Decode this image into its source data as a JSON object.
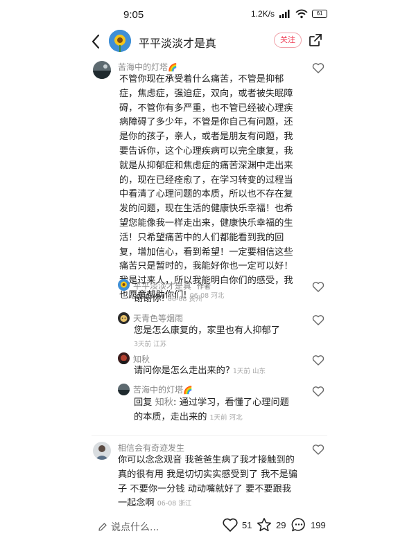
{
  "status_bar": {
    "time": "9:05",
    "network_speed": "1.2K/s",
    "battery": "61"
  },
  "header": {
    "author_name": "平平淡淡才是真",
    "follow_label": "关注"
  },
  "comments": [
    {
      "username": "苦海中的灯塔",
      "emoji": "🌈",
      "text_lines": [
        "不管你现在承受着什么痛苦，不管是抑郁",
        "症，焦虑症，强迫症，双向，或者被失眠障",
        "碍，不管你有多严重，也不管已经被心理疾",
        "病障碍了多少年，不管是你自己有问题，还",
        "是你的孩子，亲人，或者是朋友有问题，我",
        "要告诉你，这个心理疾病可以完全康复，我",
        "就是从抑郁症和焦虑症的痛苦深渊中走出来",
        "的，现在已经痊愈了，在学习转变的过程当",
        "中看清了心理问题的本质，所以也不存在复",
        "发的问题，现在生活的健康快乐幸福！也希",
        "望您能像我一样走出来，健康快乐幸福的生",
        "活！只希望痛苦中的人们都能看到我的回",
        "复，增加信心，看到希望！一定要相信这些",
        "痛苦只是暂时的，我能好你也一定可以好！",
        "我是过来人，所以我能明白你们的感受，我"
      ],
      "last_line": "也愿意帮助你们!",
      "meta": "06-08 河北",
      "replies": [
        {
          "username": "平平淡淡才是真",
          "tag": "作者",
          "text": "谢谢你!",
          "meta": "06-08 贵州"
        },
        {
          "username": "天青色等烟雨",
          "text": "您是怎么康复的，家里也有人抑郁了",
          "meta": "3天前  江苏"
        },
        {
          "username": "知秋",
          "text": "请问你是怎么走出来的?",
          "meta": "1天前  山东"
        },
        {
          "username": "苦海中的灯塔",
          "emoji": "🌈",
          "reply_prefix": "回复",
          "reply_to": "知秋",
          "text_line1": ":  通过学习，看懂了心理问题",
          "text_line2": "的本质，走出来的",
          "meta": "1天前  河北"
        }
      ]
    },
    {
      "username": "相信会有奇迹发生",
      "text_lines": [
        "你可以念念观音 我爸爸生病了我才接触到的",
        "真的很有用 我是切切实实感受到了 我不是骗",
        "子 不要你一分钱 动动嘴就好了 要不要跟我"
      ],
      "last_line": "一起念啊",
      "meta": "06-08 浙江"
    }
  ],
  "bottom_bar": {
    "input_placeholder": "说点什么...",
    "likes": "51",
    "stars": "29",
    "comments": "199"
  },
  "colors": {
    "accent": "#ef3b53",
    "meta_gray": "#a7a7a7",
    "name_gray": "#8a8a8a"
  }
}
